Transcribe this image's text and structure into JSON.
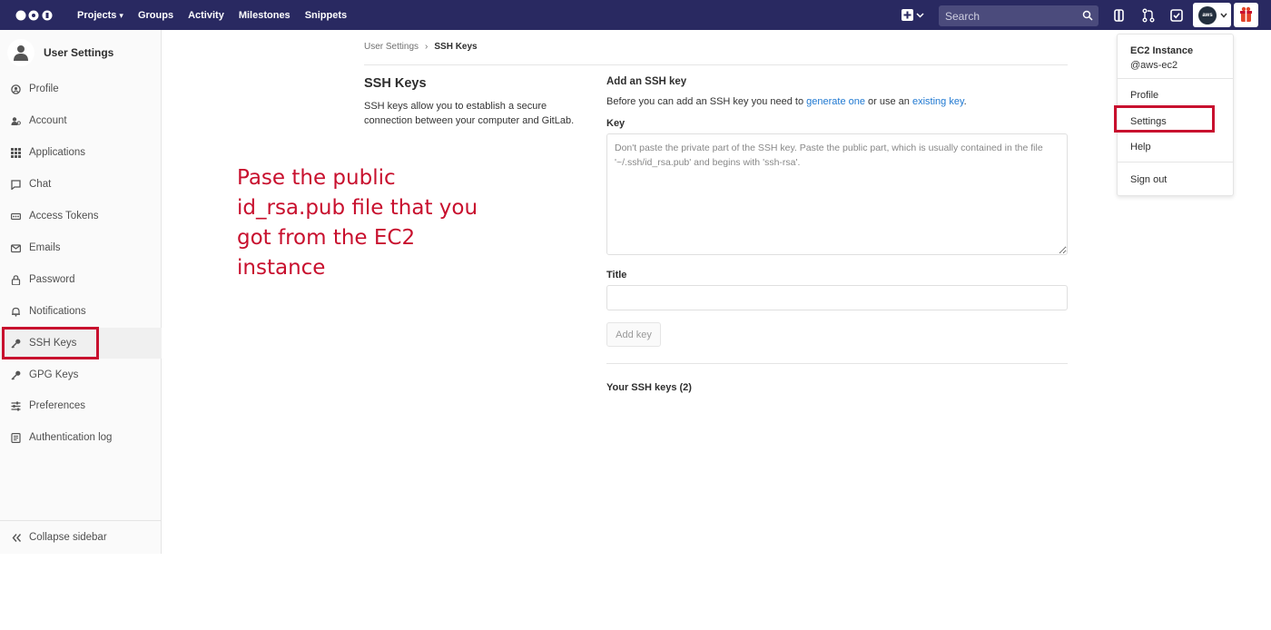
{
  "topbar": {
    "nav": [
      {
        "label": "Projects",
        "has_caret": true
      },
      {
        "label": "Groups",
        "has_caret": false
      },
      {
        "label": "Activity",
        "has_caret": false
      },
      {
        "label": "Milestones",
        "has_caret": false
      },
      {
        "label": "Snippets",
        "has_caret": false
      }
    ],
    "search_placeholder": "Search",
    "avatar_text": "aws",
    "bg_color": "#292961"
  },
  "sidebar": {
    "title": "User Settings",
    "items": [
      {
        "label": "Profile",
        "icon": "profile-icon"
      },
      {
        "label": "Account",
        "icon": "account-icon"
      },
      {
        "label": "Applications",
        "icon": "applications-icon"
      },
      {
        "label": "Chat",
        "icon": "chat-icon"
      },
      {
        "label": "Access Tokens",
        "icon": "token-icon"
      },
      {
        "label": "Emails",
        "icon": "email-icon"
      },
      {
        "label": "Password",
        "icon": "lock-icon"
      },
      {
        "label": "Notifications",
        "icon": "bell-icon"
      },
      {
        "label": "SSH Keys",
        "icon": "key-icon",
        "active": true
      },
      {
        "label": "GPG Keys",
        "icon": "key-icon"
      },
      {
        "label": "Preferences",
        "icon": "preferences-icon"
      },
      {
        "label": "Authentication log",
        "icon": "log-icon"
      }
    ],
    "collapse_label": "Collapse sidebar"
  },
  "breadcrumb": {
    "parent": "User Settings",
    "current": "SSH Keys"
  },
  "section": {
    "title": "SSH Keys",
    "description": "SSH keys allow you to establish a secure connection between your computer and GitLab."
  },
  "annotation": "Pase the public id_rsa.pub file that you got from the EC2 instance",
  "form": {
    "heading": "Add an SSH key",
    "intro_before": "Before you can add an SSH key you need to ",
    "intro_link1": "generate one",
    "intro_mid": " or use an ",
    "intro_link2": "existing key",
    "intro_end": ".",
    "key_label": "Key",
    "key_placeholder": "Don't paste the private part of the SSH key. Paste the public part, which is usually contained in the file '~/.ssh/id_rsa.pub' and begins with 'ssh-rsa'.",
    "title_label": "Title",
    "title_value": "",
    "add_button": "Add key",
    "your_keys": "Your SSH keys (2)"
  },
  "dropdown": {
    "name": "EC2 Instance",
    "username": "@aws-ec2",
    "items": [
      "Profile",
      "Settings",
      "Help",
      "Sign out"
    ]
  }
}
